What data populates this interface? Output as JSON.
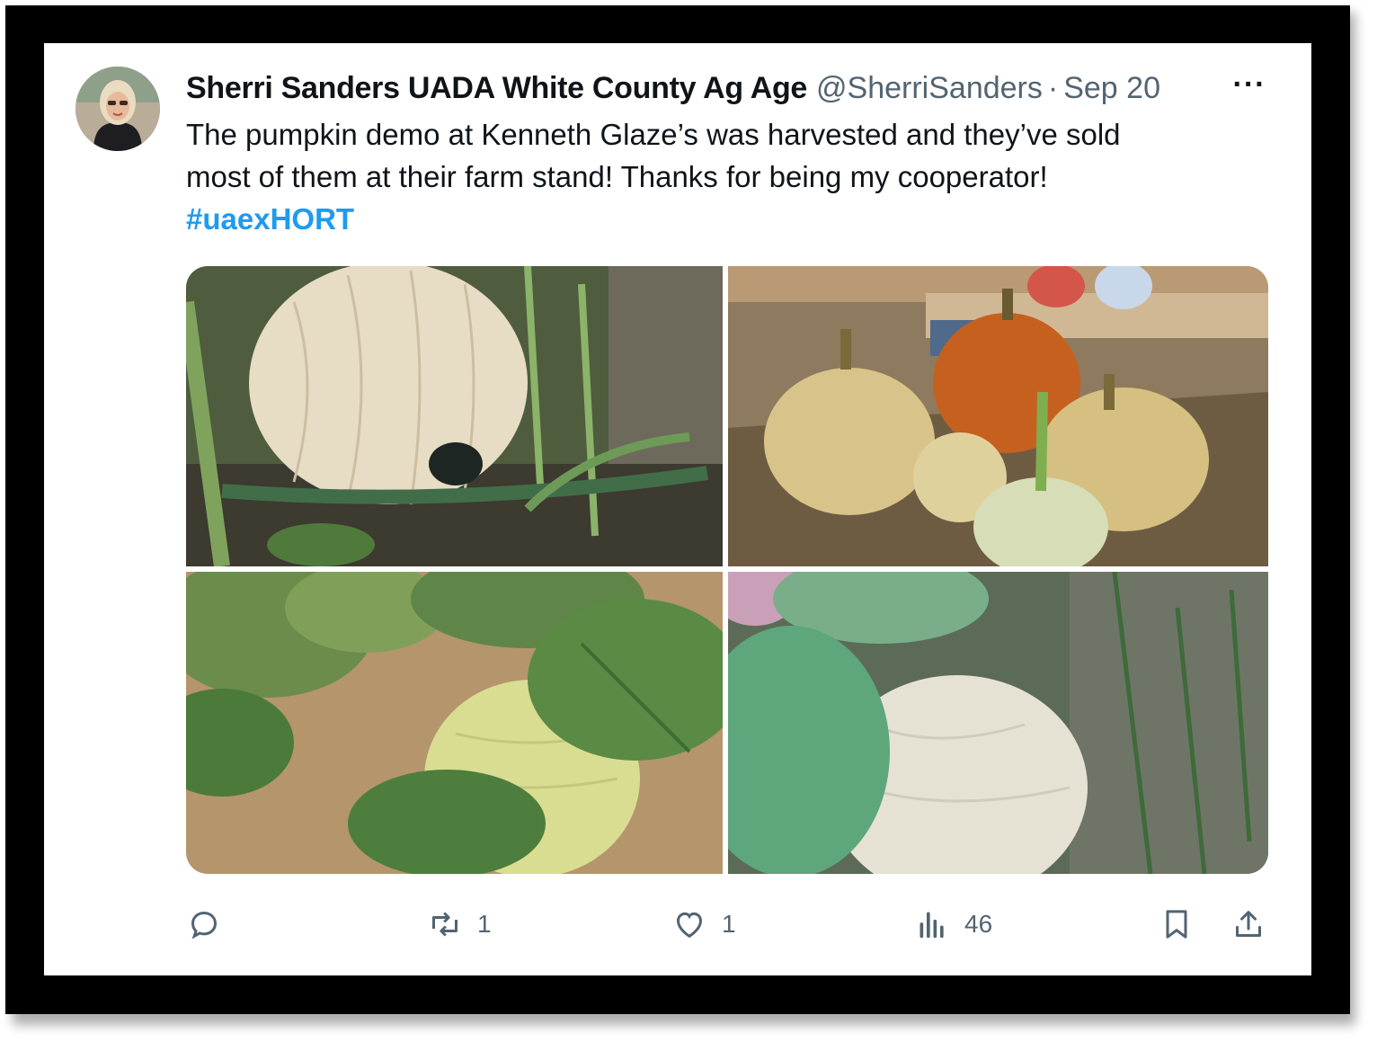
{
  "tweet": {
    "author_name": "Sherri Sanders UADA White County Ag Age",
    "handle": "@SherriSanders",
    "separator": "·",
    "date": "Sep 20",
    "more_label": "···",
    "text_line1": "The pumpkin demo at Kenneth Glaze’s was harvested and they’ve sold",
    "text_line2": "most of them at their farm stand!  Thanks for being my cooperator!",
    "hashtag": "#uaexHORT"
  },
  "media": {
    "images": [
      {
        "description_icon": "pumpkin-photo"
      },
      {
        "description_icon": "pumpkin-photo"
      },
      {
        "description_icon": "pumpkin-photo"
      },
      {
        "description_icon": "pumpkin-photo"
      }
    ]
  },
  "actions": {
    "reply_icon": "reply-icon",
    "retweet_count": "1",
    "like_count": "1",
    "views_count": "46",
    "bookmark_icon": "bookmark-icon",
    "share_icon": "share-icon"
  },
  "colors": {
    "link": "#1d9bf0",
    "secondary_text": "#536471",
    "primary_text": "#0f1419"
  }
}
